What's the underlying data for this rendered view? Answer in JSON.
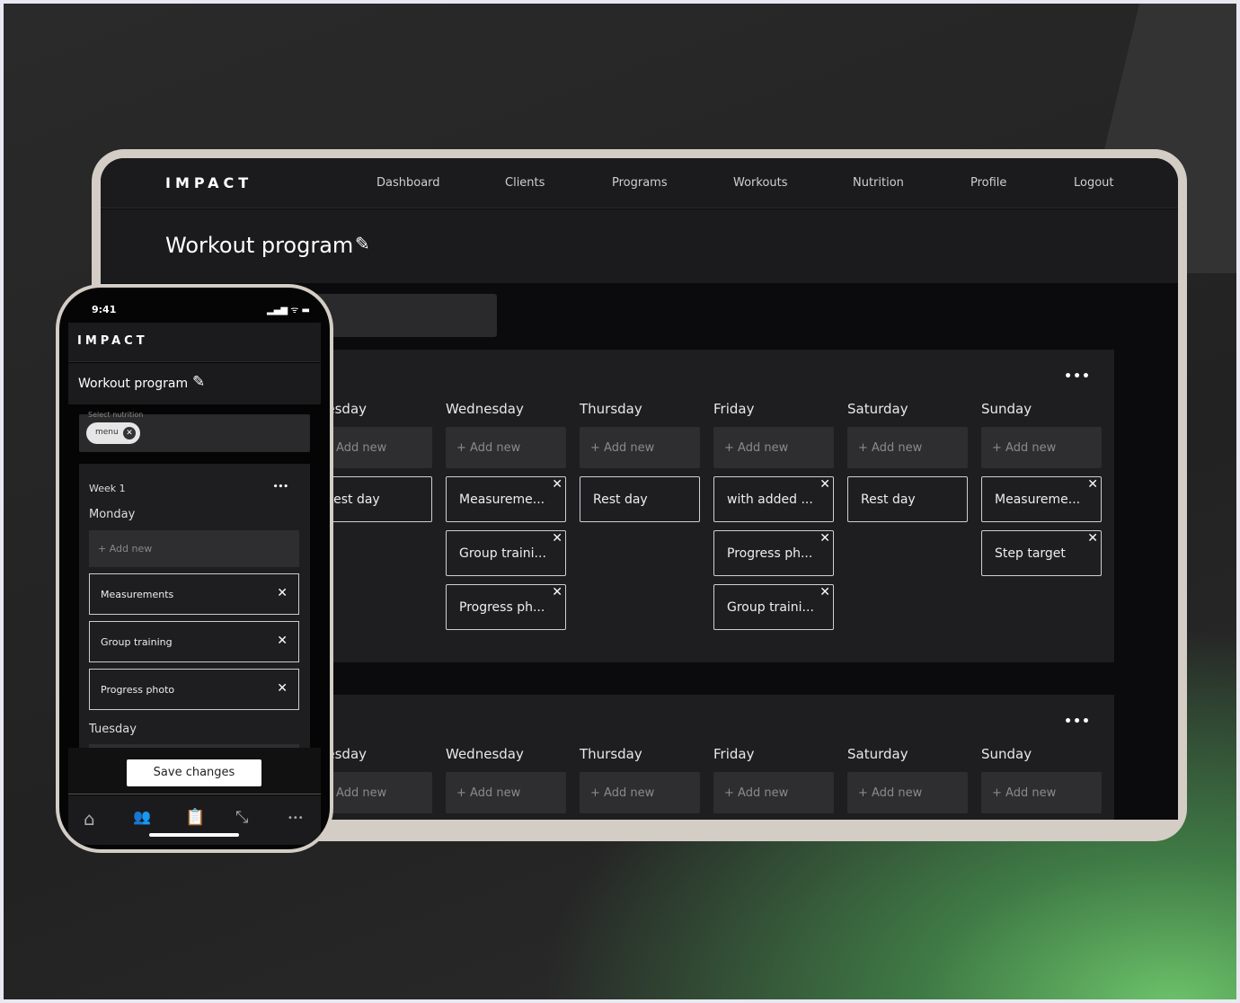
{
  "app": {
    "logo": "IMPACT"
  },
  "nav": [
    "Dashboard",
    "Clients",
    "Programs",
    "Workouts",
    "Nutrition",
    "Profile",
    "Logout"
  ],
  "page_title": "Workout program",
  "weeks": [
    {
      "days": [
        {
          "name": "Tuesday",
          "add": "+ Add new",
          "items": [
            "Rest day"
          ]
        },
        {
          "name": "Wednesday",
          "add": "+ Add new",
          "items": [
            "Measureme...",
            "Group traini...",
            "Progress ph..."
          ]
        },
        {
          "name": "Thursday",
          "add": "+ Add new",
          "items": [
            "Rest day"
          ]
        },
        {
          "name": "Friday",
          "add": "+ Add new",
          "items": [
            "with added ...",
            "Progress ph...",
            "Group traini..."
          ]
        },
        {
          "name": "Saturday",
          "add": "+ Add new",
          "items": [
            "Rest day"
          ]
        },
        {
          "name": "Sunday",
          "add": "+ Add new",
          "items": [
            "Measureme...",
            "Step target"
          ]
        }
      ]
    },
    {
      "days": [
        {
          "name": "Tuesday",
          "add": "+ Add new"
        },
        {
          "name": "Wednesday",
          "add": "+ Add new"
        },
        {
          "name": "Thursday",
          "add": "+ Add new"
        },
        {
          "name": "Friday",
          "add": "+ Add new"
        },
        {
          "name": "Saturday",
          "add": "+ Add new"
        },
        {
          "name": "Sunday",
          "add": "+ Add new"
        }
      ]
    }
  ],
  "mobile": {
    "time": "9:41",
    "logo": "IMPACT",
    "title": "Workout program",
    "nutrition_label": "Select nutrition",
    "chip": "menu",
    "week": "Week 1",
    "day1": "Monday",
    "add": "+ Add new",
    "items": [
      "Measurements",
      "Group training",
      "Progress photo"
    ],
    "day2": "Tuesday",
    "save": "Save changes",
    "tabs": [
      "home-icon",
      "clients-icon",
      "programs-icon",
      "workouts-icon",
      "more-icon"
    ]
  }
}
